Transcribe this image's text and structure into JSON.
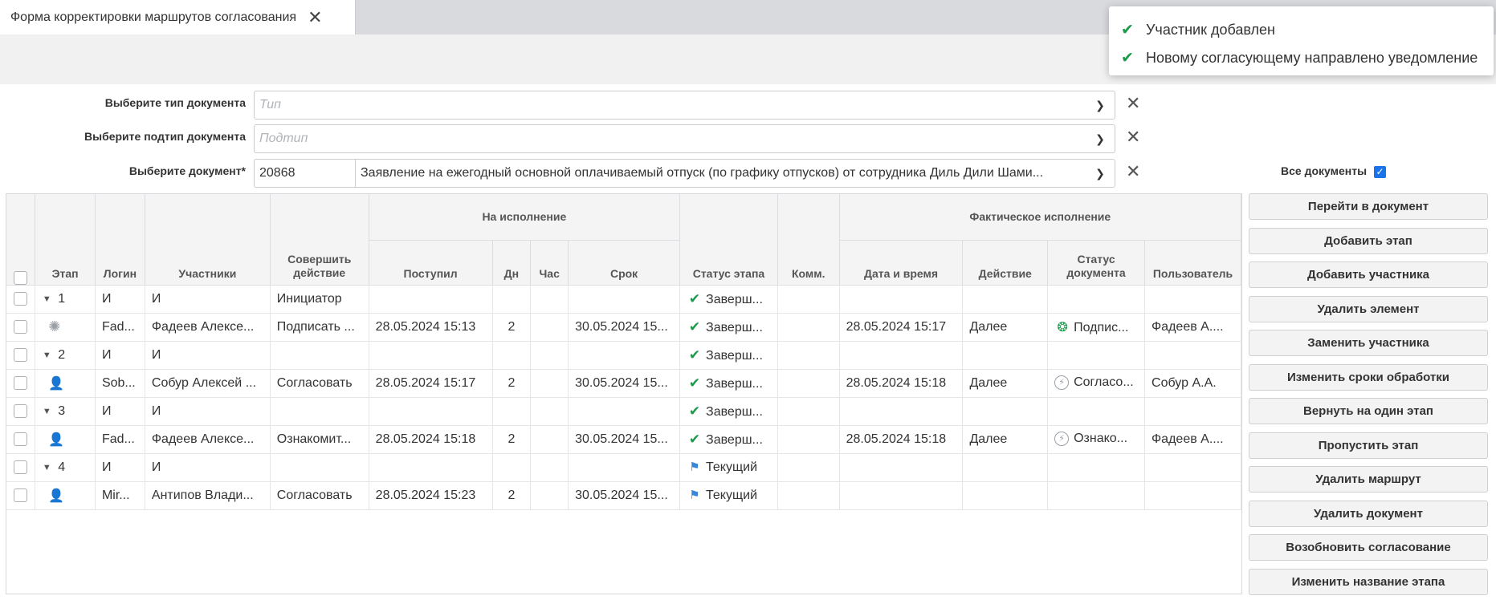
{
  "tab": {
    "title": "Форма корректировки маршрутов согласования"
  },
  "toast": {
    "messages": [
      "Участник добавлен",
      "Новому согласующему направлено уведомление"
    ]
  },
  "filters": {
    "type_label": "Выберите тип документа",
    "type_placeholder": "Тип",
    "subtype_label": "Выберите подтип документа",
    "subtype_placeholder": "Подтип",
    "document_label": "Выберите документ*",
    "document_number": "20868",
    "document_title": "Заявление на ежегодный основной оплачиваемый отпуск (по графику отпусков) от сотрудника Диль Дили Шами...",
    "all_docs_label": "Все документы",
    "all_docs_checked": true
  },
  "grid": {
    "group_headers": {
      "execution": "На исполнение",
      "actual": "Фактическое исполнение"
    },
    "headers": {
      "stage": "Этап",
      "login": "Логин",
      "participants": "Участники",
      "action": "Совершить действие",
      "received": "Поступил",
      "days": "Дн",
      "hours": "Час",
      "deadline": "Срок",
      "stage_status": "Статус этапа",
      "comment": "Комм.",
      "datetime": "Дата и время",
      "fact_action": "Действие",
      "doc_status": "Статус документа",
      "user": "Пользователь"
    },
    "rows": [
      {
        "kind": "stage",
        "stage": "1",
        "login": "И",
        "participant": "И",
        "action": "Инициатор",
        "received": "",
        "days": "",
        "hours": "",
        "deadline": "",
        "stage_status": "Заверш...",
        "status_icon": "check",
        "comment": "",
        "datetime": "",
        "fact_action": "",
        "doc_status": "",
        "doc_icon": "",
        "user": ""
      },
      {
        "kind": "person",
        "icon": "gear",
        "login": "Fad...",
        "participant": "Фадеев Алексе...",
        "action": "Подписать ...",
        "received": "28.05.2024 15:13",
        "days": "2",
        "hours": "",
        "deadline": "30.05.2024 15...",
        "stage_status": "Заверш...",
        "status_icon": "check",
        "comment": "",
        "datetime": "28.05.2024 15:17",
        "fact_action": "Далее",
        "doc_status": "Подпис...",
        "doc_icon": "badge",
        "user": "Фадеев А...."
      },
      {
        "kind": "stage",
        "stage": "2",
        "login": "И",
        "participant": "И",
        "action": "",
        "received": "",
        "days": "",
        "hours": "",
        "deadline": "",
        "stage_status": "Заверш...",
        "status_icon": "check",
        "comment": "",
        "datetime": "",
        "fact_action": "",
        "doc_status": "",
        "doc_icon": "",
        "user": ""
      },
      {
        "kind": "person",
        "icon": "person",
        "login": "Sob...",
        "participant": "Собур Алексей ...",
        "action": "Согласовать",
        "received": "28.05.2024 15:17",
        "days": "2",
        "hours": "",
        "deadline": "30.05.2024 15...",
        "stage_status": "Заверш...",
        "status_icon": "check",
        "comment": "",
        "datetime": "28.05.2024 15:18",
        "fact_action": "Далее",
        "doc_status": "Согласо...",
        "doc_icon": "bolt",
        "user": "Собур А.А."
      },
      {
        "kind": "stage",
        "stage": "3",
        "login": "И",
        "participant": "И",
        "action": "",
        "received": "",
        "days": "",
        "hours": "",
        "deadline": "",
        "stage_status": "Заверш...",
        "status_icon": "check",
        "comment": "",
        "datetime": "",
        "fact_action": "",
        "doc_status": "",
        "doc_icon": "",
        "user": ""
      },
      {
        "kind": "person",
        "icon": "person",
        "login": "Fad...",
        "participant": "Фадеев Алексе...",
        "action": "Ознакомит...",
        "received": "28.05.2024 15:18",
        "days": "2",
        "hours": "",
        "deadline": "30.05.2024 15...",
        "stage_status": "Заверш...",
        "status_icon": "check",
        "comment": "",
        "datetime": "28.05.2024 15:18",
        "fact_action": "Далее",
        "doc_status": "Ознако...",
        "doc_icon": "bolt",
        "user": "Фадеев А...."
      },
      {
        "kind": "stage",
        "stage": "4",
        "login": "И",
        "participant": "И",
        "action": "",
        "received": "",
        "days": "",
        "hours": "",
        "deadline": "",
        "stage_status": "Текущий",
        "status_icon": "flag",
        "comment": "",
        "datetime": "",
        "fact_action": "",
        "doc_status": "",
        "doc_icon": "",
        "user": ""
      },
      {
        "kind": "person",
        "icon": "person",
        "login": "Mir...",
        "participant": "Антипов Влади...",
        "action": "Согласовать",
        "received": "28.05.2024 15:23",
        "days": "2",
        "hours": "",
        "deadline": "30.05.2024 15...",
        "stage_status": "Текущий",
        "status_icon": "flag",
        "comment": "",
        "datetime": "",
        "fact_action": "",
        "doc_status": "",
        "doc_icon": "",
        "user": ""
      }
    ]
  },
  "side_buttons": [
    "Перейти в документ",
    "Добавить этап",
    "Добавить участника",
    "Удалить элемент",
    "Заменить участника",
    "Изменить сроки обработки",
    "Вернуть на один этап",
    "Пропустить этап",
    "Удалить маршрут",
    "Удалить документ",
    "Возобновить согласование",
    "Изменить название этапа"
  ],
  "colors": {
    "accent": "#1a73e8",
    "success": "#1a9a4a",
    "flag": "#3a86d6"
  }
}
